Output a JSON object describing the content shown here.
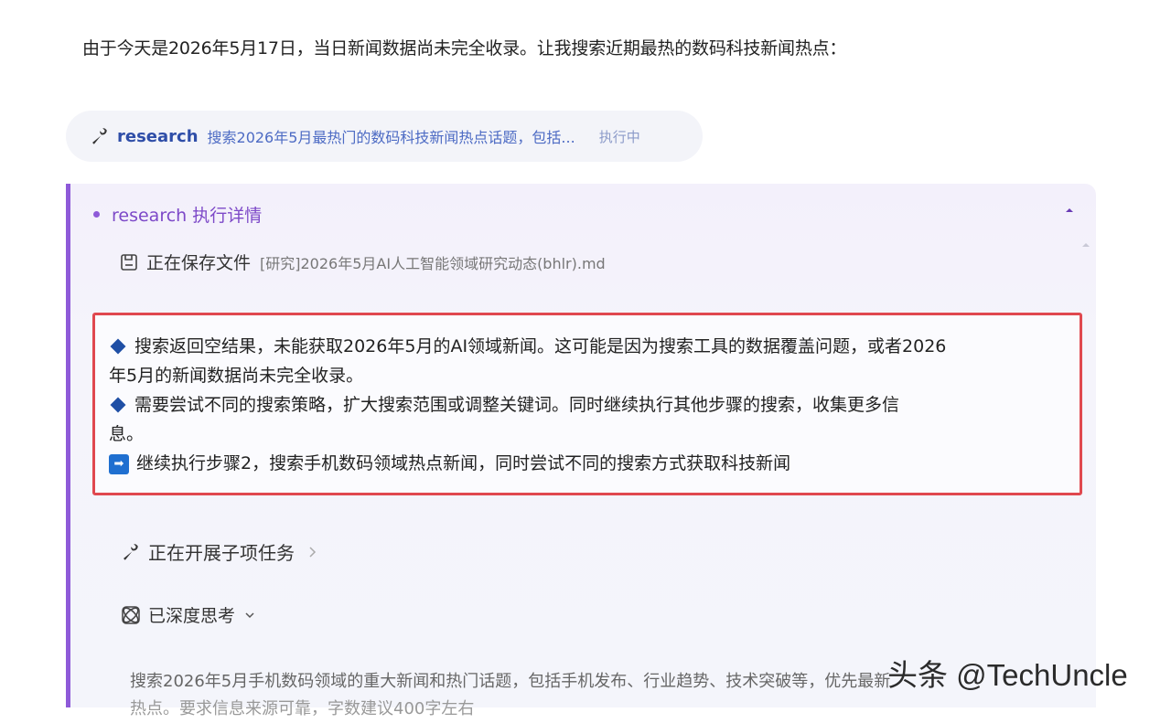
{
  "intro": "由于今天是2026年5月17日，当日新闻数据尚未完全收录。让我搜索近期最热的数码科技新闻热点：",
  "tool_call": {
    "name": "research",
    "description": "搜索2026年5月最热门的数码科技新闻热点话题，包括...",
    "status": "执行中"
  },
  "details": {
    "title": "research 执行详情",
    "saving_label": "正在保存文件",
    "saving_file": "[研究]2026年5月AI人工智能领域研究动态(bhlr).md",
    "highlight_lines": [
      "搜索返回空结果，未能获取2026年5月的AI领域新闻。这可能是因为搜索工具的数据覆盖问题，或者2026",
      "年5月的新闻数据尚未完全收录。",
      "需要尝试不同的搜索策略，扩大搜索范围或调整关键词。同时继续执行其他步骤的搜索，收集更多信",
      "息。",
      "继续执行步骤2，搜索手机数码领域热点新闻，同时尝试不同的搜索方式获取科技新闻"
    ],
    "subtask_label": "正在开展子项任务",
    "thinking_label": "已深度思考",
    "bottom_text": "搜索2026年5月手机数码领域的重大新闻和热门话题，包括手机发布、行业趋势、技术突破等，优先最新",
    "bottom_text_2": "热点。要求信息来源可靠，字数建议400字左右"
  },
  "watermark": "头条 @TechUncle",
  "colors": {
    "accent_purple": "#8e5ad8",
    "link_blue": "#2f4ea8",
    "highlight_red": "#e0484f",
    "bullet_blue": "#1f4fa5"
  }
}
